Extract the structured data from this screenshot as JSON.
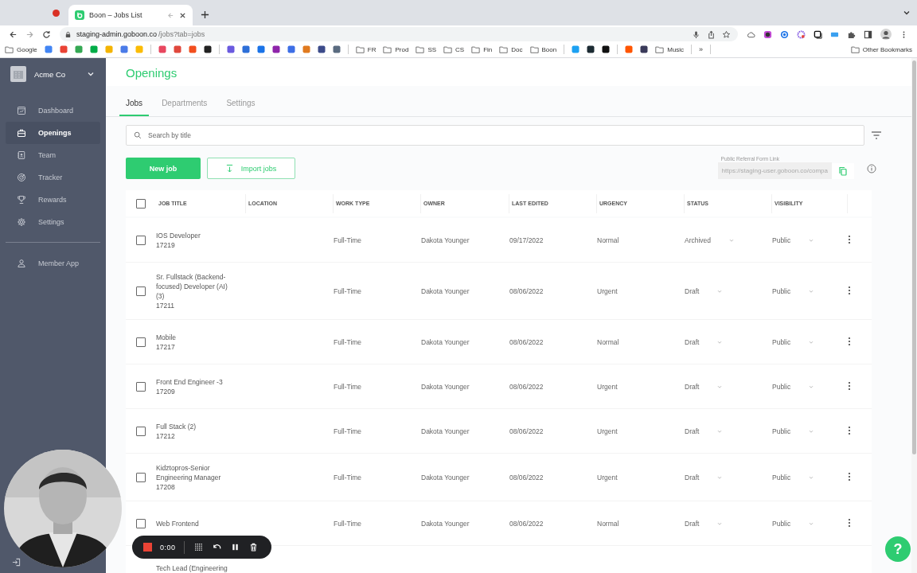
{
  "browser": {
    "tab": {
      "title": "Boon – Jobs List"
    },
    "url_host": "staging-admin.goboon.co",
    "url_path": "/jobs?tab=jobs",
    "bookmarks": [
      {
        "kind": "folder",
        "label": "Google"
      },
      {
        "kind": "site",
        "color": "#4285f4"
      },
      {
        "kind": "site",
        "color": "#ea4335"
      },
      {
        "kind": "site",
        "color": "#34a853"
      },
      {
        "kind": "site",
        "color": "#00ac47"
      },
      {
        "kind": "site",
        "color": "#f4b400"
      },
      {
        "kind": "site",
        "color": "#4a7be8"
      },
      {
        "kind": "site",
        "color": "#fbbc04"
      },
      {
        "kind": "separator"
      },
      {
        "kind": "site",
        "color": "#e8475f"
      },
      {
        "kind": "site",
        "color": "#e0483d"
      },
      {
        "kind": "site",
        "color": "#f24e1e"
      },
      {
        "kind": "site",
        "color": "#222222"
      },
      {
        "kind": "separator"
      },
      {
        "kind": "site",
        "color": "#6a5adf"
      },
      {
        "kind": "site",
        "color": "#2d6fd8"
      },
      {
        "kind": "site",
        "color": "#1a73e8"
      },
      {
        "kind": "site",
        "color": "#8e24aa"
      },
      {
        "kind": "site",
        "color": "#3d6ee6"
      },
      {
        "kind": "site",
        "color": "#e07a1f"
      },
      {
        "kind": "site",
        "color": "#3c4b8a"
      },
      {
        "kind": "site",
        "color": "#5a6b80"
      },
      {
        "kind": "separator"
      },
      {
        "kind": "folder",
        "label": "FR"
      },
      {
        "kind": "folder",
        "label": "Prod"
      },
      {
        "kind": "folder",
        "label": "SS"
      },
      {
        "kind": "folder",
        "label": "CS"
      },
      {
        "kind": "folder",
        "label": "Fin"
      },
      {
        "kind": "folder",
        "label": "Doc"
      },
      {
        "kind": "folder",
        "label": "Boon"
      },
      {
        "kind": "separator"
      },
      {
        "kind": "site",
        "color": "#1da1f2"
      },
      {
        "kind": "site",
        "color": "#1c2b33"
      },
      {
        "kind": "site",
        "color": "#111111"
      },
      {
        "kind": "separator"
      },
      {
        "kind": "site",
        "color": "#ff5500"
      },
      {
        "kind": "site",
        "color": "#3a3a5a"
      },
      {
        "kind": "folder",
        "label": "Music"
      },
      {
        "kind": "separator"
      },
      {
        "kind": "overflow",
        "label": "»"
      },
      {
        "kind": "separator"
      },
      {
        "kind": "folder",
        "label": "Other Bookmarks"
      }
    ]
  },
  "sidebar": {
    "company": "Acme Co",
    "items": [
      {
        "label": "Dashboard",
        "selected": false
      },
      {
        "label": "Openings",
        "selected": true
      },
      {
        "label": "Team",
        "selected": false
      },
      {
        "label": "Tracker",
        "selected": false
      },
      {
        "label": "Rewards",
        "selected": false
      },
      {
        "label": "Settings",
        "selected": false
      }
    ],
    "footer_items": [
      {
        "label": "Member App",
        "selected": false
      }
    ]
  },
  "page": {
    "title": "Openings",
    "tabs": [
      {
        "label": "Jobs",
        "selected": true
      },
      {
        "label": "Departments",
        "selected": false
      },
      {
        "label": "Settings",
        "selected": false
      }
    ],
    "search": {
      "placeholder": "Search by title"
    },
    "buttons": {
      "primary": "New job",
      "secondary": "Import jobs"
    },
    "referral": {
      "label": "Public Referral Form Link",
      "value": "https://staging-user.goboon.co/compa"
    },
    "table": {
      "select_all_checked": false,
      "columns": [
        "JOB TITLE",
        "LOCATION",
        "WORK TYPE",
        "OWNER",
        "LAST EDITED",
        "URGENCY",
        "STATUS",
        "VISIBILITY"
      ],
      "rows": [
        {
          "checked": false,
          "title": "IOS Developer",
          "id": "17219",
          "work_type": "Full-Time",
          "owner": "Dakota Younger",
          "last_edited": "09/17/2022",
          "urgency": "Normal",
          "status": "Archived",
          "visibility": "Public"
        },
        {
          "checked": false,
          "title": "Sr. Fullstack (Backend-focused) Developer (AI) (3)",
          "id": "17211",
          "work_type": "Full-Time",
          "owner": "Dakota Younger",
          "last_edited": "08/06/2022",
          "urgency": "Urgent",
          "status": "Draft",
          "visibility": "Public"
        },
        {
          "checked": false,
          "title": "Mobile",
          "id": "17217",
          "work_type": "Full-Time",
          "owner": "Dakota Younger",
          "last_edited": "08/06/2022",
          "urgency": "Normal",
          "status": "Draft",
          "visibility": "Public"
        },
        {
          "checked": false,
          "title": "Front End Engineer -3",
          "id": "17209",
          "work_type": "Full-Time",
          "owner": "Dakota Younger",
          "last_edited": "08/06/2022",
          "urgency": "Urgent",
          "status": "Draft",
          "visibility": "Public"
        },
        {
          "checked": false,
          "title": "Full Stack (2)",
          "id": "17212",
          "work_type": "Full-Time",
          "owner": "Dakota Younger",
          "last_edited": "08/06/2022",
          "urgency": "Urgent",
          "status": "Draft",
          "visibility": "Public"
        },
        {
          "checked": false,
          "title": "Kidztopros-Senior Engineering Manager",
          "id": "17208",
          "work_type": "Full-Time",
          "owner": "Dakota Younger",
          "last_edited": "08/06/2022",
          "urgency": "Urgent",
          "status": "Draft",
          "visibility": "Public"
        },
        {
          "checked": false,
          "title": "Web Frontend",
          "work_type": "Full-Time",
          "owner": "Dakota Younger",
          "last_edited": "08/06/2022",
          "urgency": "Normal",
          "status": "Draft",
          "visibility": "Public"
        },
        {
          "title": "Tech Lead (Engineering"
        }
      ]
    }
  },
  "recorder": {
    "time": "0:00"
  },
  "help": {
    "label": "?"
  }
}
